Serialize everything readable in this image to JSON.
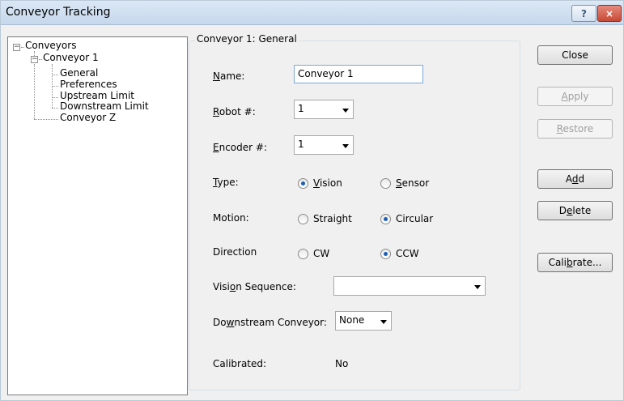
{
  "window": {
    "title": "Conveyor Tracking"
  },
  "titlebar_buttons": {
    "help": "?",
    "close": "×"
  },
  "tree": {
    "root": "Conveyors",
    "child": "Conveyor 1",
    "leaves": [
      "General",
      "Preferences",
      "Upstream Limit",
      "Downstream Limit"
    ],
    "sibling": "Conveyor Z"
  },
  "group": {
    "title": "Conveyor 1: General"
  },
  "form": {
    "name": {
      "label_m": "N",
      "label_rest": "ame:",
      "value": "Conveyor 1"
    },
    "robot": {
      "label_m": "R",
      "label_rest": "obot #:",
      "value": "1"
    },
    "encoder": {
      "label_m": "E",
      "label_rest": "ncoder #:",
      "value": "1"
    },
    "type": {
      "label_m": "T",
      "label_rest": "ype:",
      "opt1_m": "V",
      "opt1_rest": "ision",
      "opt2_m": "S",
      "opt2_rest": "ensor",
      "selected": "Vision"
    },
    "motion": {
      "label": "Motion:",
      "opt1": "Straight",
      "opt2": "Circular",
      "selected": "Circular"
    },
    "direction": {
      "label": "Direction",
      "opt1": "CW",
      "opt2": "CCW",
      "selected": "CCW"
    },
    "vision_sequence": {
      "label_pre": "Visi",
      "label_m": "o",
      "label_post": "n Sequence:",
      "value": ""
    },
    "downstream": {
      "label_pre": "Do",
      "label_m": "w",
      "label_post": "nstream Conveyor:",
      "value": "None"
    },
    "calibrated": {
      "label": "Calibrated:",
      "value": "No"
    }
  },
  "buttons": {
    "close": "Close",
    "apply_m": "A",
    "apply_rest": "pply",
    "restore_m": "R",
    "restore_rest": "estore",
    "add_pre": "A",
    "add_m": "d",
    "add_post": "d",
    "delete_pre": "D",
    "delete_m": "e",
    "delete_post": "lete",
    "calibrate_pre": "Cali",
    "calibrate_m": "b",
    "calibrate_post": "rate..."
  }
}
